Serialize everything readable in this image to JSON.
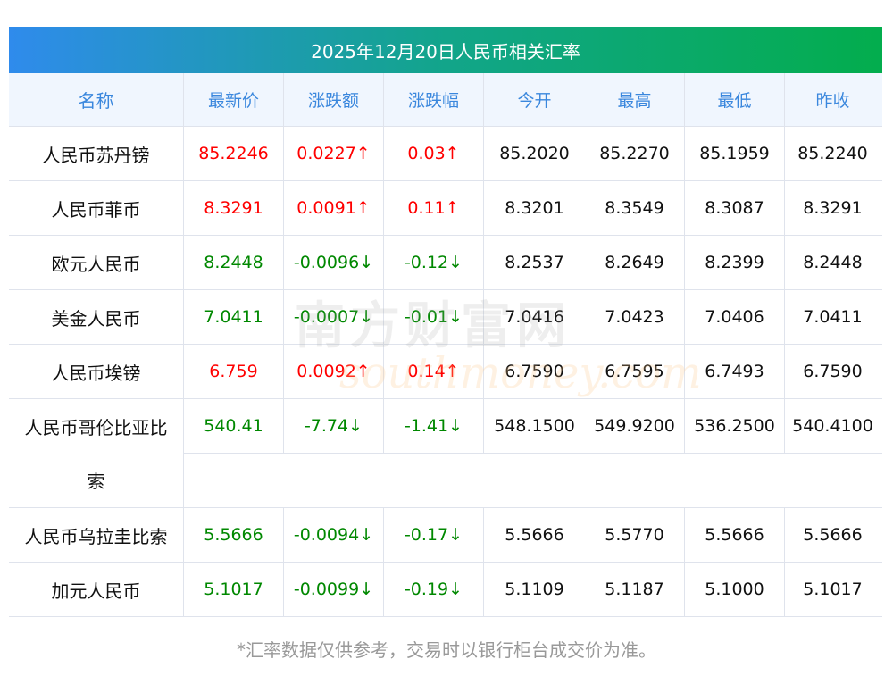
{
  "title": "2025年12月20日人民币相关汇率",
  "headers": [
    "名称",
    "最新价",
    "涨跌额",
    "涨跌幅",
    "今开",
    "最高",
    "最低",
    "昨收"
  ],
  "rows": [
    {
      "name": "人民币苏丹镑",
      "latest": "85.2246",
      "change": "0.0227↑",
      "pct": "0.03↑",
      "open": "85.2020",
      "high": "85.2270",
      "low": "85.1959",
      "prev": "85.2240",
      "dir": "up"
    },
    {
      "name": "人民币菲币",
      "latest": "8.3291",
      "change": "0.0091↑",
      "pct": "0.11↑",
      "open": "8.3201",
      "high": "8.3549",
      "low": "8.3087",
      "prev": "8.3291",
      "dir": "up"
    },
    {
      "name": "欧元人民币",
      "latest": "8.2448",
      "change": "-0.0096↓",
      "pct": "-0.12↓",
      "open": "8.2537",
      "high": "8.2649",
      "low": "8.2399",
      "prev": "8.2448",
      "dir": "dn"
    },
    {
      "name": "美金人民币",
      "latest": "7.0411",
      "change": "-0.0007↓",
      "pct": "-0.01↓",
      "open": "7.0416",
      "high": "7.0423",
      "low": "7.0406",
      "prev": "7.0411",
      "dir": "dn"
    },
    {
      "name": "人民币埃镑",
      "latest": "6.759",
      "change": "0.0092↑",
      "pct": "0.14↑",
      "open": "6.7590",
      "high": "6.7595",
      "low": "6.7493",
      "prev": "6.7590",
      "dir": "up"
    },
    {
      "name_line1": "人民币哥伦比亚比",
      "name_line2": "索",
      "latest": "540.41",
      "change": "-7.74↓",
      "pct": "-1.41↓",
      "open": "548.1500",
      "high": "549.9200",
      "low": "536.2500",
      "prev": "540.4100",
      "dir": "dn"
    },
    {
      "name": "人民币乌拉圭比索",
      "latest": "5.5666",
      "change": "-0.0094↓",
      "pct": "-0.17↓",
      "open": "5.5666",
      "high": "5.5770",
      "low": "5.5666",
      "prev": "5.5666",
      "dir": "dn"
    },
    {
      "name": "加元人民币",
      "latest": "5.1017",
      "change": "-0.0099↓",
      "pct": "-0.19↓",
      "open": "5.1109",
      "high": "5.1187",
      "low": "5.1000",
      "prev": "5.1017",
      "dir": "dn"
    }
  ],
  "watermark": {
    "cn": "南方财富网",
    "en": "southmoney.com"
  },
  "footnote": "*汇率数据仅供参考，交易时以银行柜台成交价为准。",
  "colors": {
    "up": "#ff0000",
    "down": "#008800",
    "header_text": "#3a87dd"
  }
}
